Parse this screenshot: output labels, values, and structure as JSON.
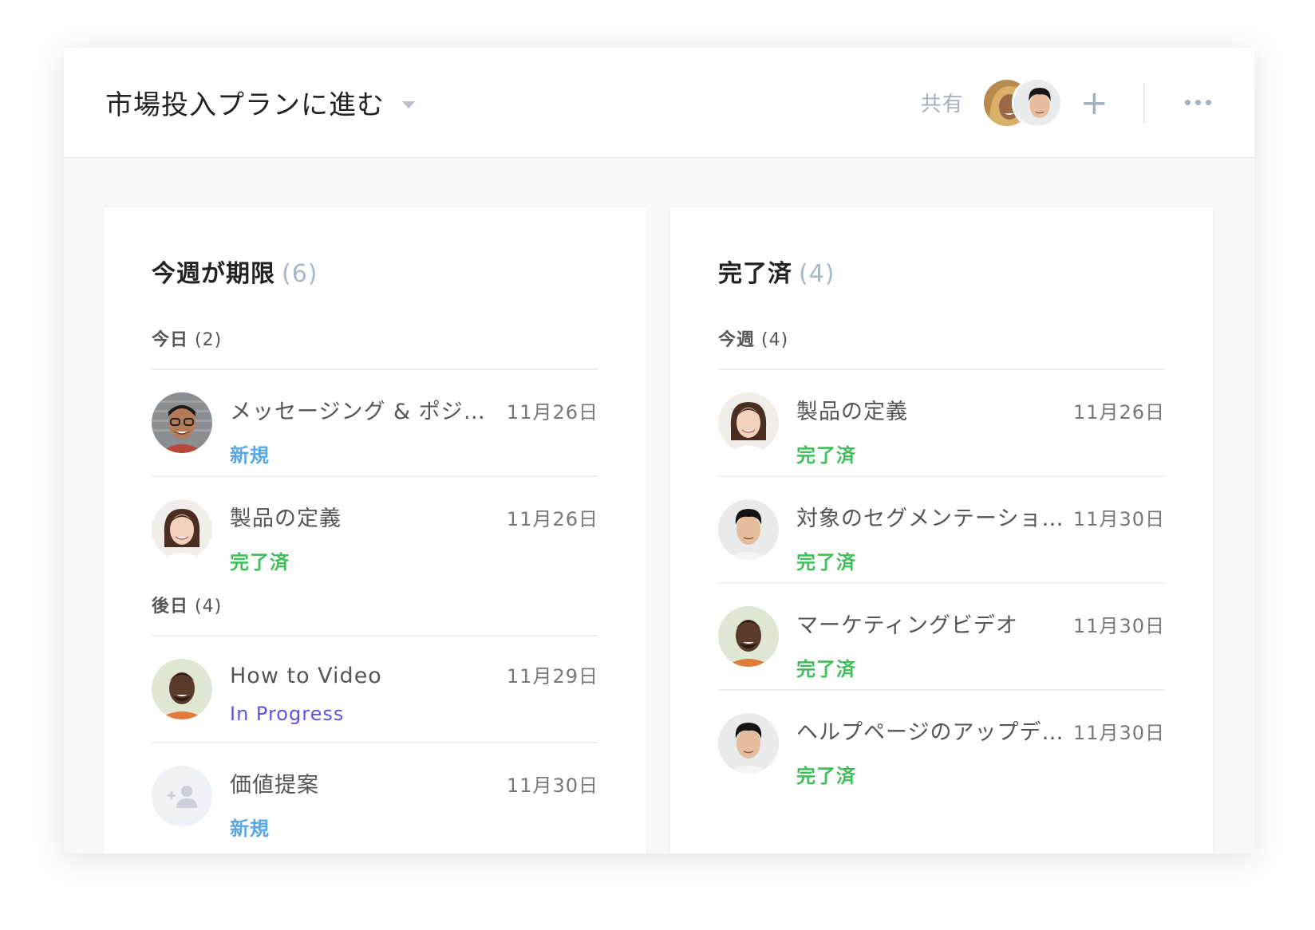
{
  "header": {
    "project_title": "市場投入プランに進む",
    "share_label": "共有",
    "add_symbol": "+"
  },
  "left_panel": {
    "title": "今週が期限",
    "count": "(6)",
    "groups": [
      {
        "label": "今日",
        "count": "(2)",
        "tasks": [
          {
            "title": "メッセージング & ポジショニング",
            "date": "11月26日",
            "status": "新規",
            "avatar": "man-glasses"
          },
          {
            "title": "製品の定義",
            "date": "11月26日",
            "status": "完了済",
            "avatar": "woman"
          }
        ]
      },
      {
        "label": "後日",
        "count": "(4)",
        "tasks": [
          {
            "title": "How to Video",
            "date": "11月29日",
            "status": "In Progress",
            "avatar": "man-dark"
          },
          {
            "title": "価値提案",
            "date": "11月30日",
            "status": "新規",
            "avatar": "unassigned"
          }
        ]
      }
    ]
  },
  "right_panel": {
    "title": "完了済",
    "count": "(4)",
    "groups": [
      {
        "label": "今週",
        "count": "(4)",
        "tasks": [
          {
            "title": "製品の定義",
            "date": "11月26日",
            "status": "完了済",
            "avatar": "woman"
          },
          {
            "title": "対象のセグメンテーション",
            "date": "11月30日",
            "status": "完了済",
            "avatar": "man-asian"
          },
          {
            "title": "マーケティングビデオ",
            "date": "11月30日",
            "status": "完了済",
            "avatar": "man-dark"
          },
          {
            "title": "ヘルプページのアップデート",
            "date": "11月30日",
            "status": "完了済",
            "avatar": "man-asian"
          }
        ]
      }
    ]
  },
  "colors": {
    "status_new": "#5aa7e6",
    "status_done": "#3fbf5a",
    "status_progress": "#5a55e0",
    "muted": "#a7b0bd"
  }
}
